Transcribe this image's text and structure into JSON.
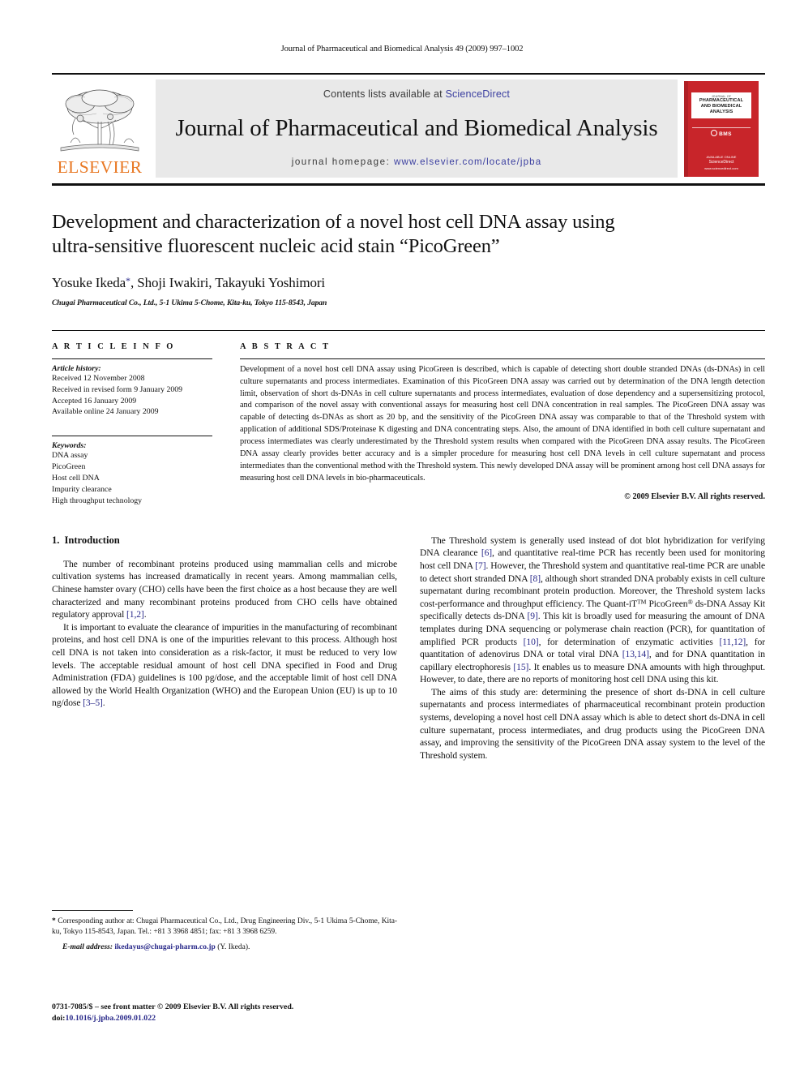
{
  "running_head": "Journal of Pharmaceutical and Biomedical Analysis 49 (2009) 997–1002",
  "masthead": {
    "publisher_logo_label": "ELSEVIER",
    "contents_prefix": "Contents lists available at ",
    "contents_link": "ScienceDirect",
    "journal_name": "Journal of Pharmaceutical and Biomedical Analysis",
    "homepage_prefix": "journal homepage: ",
    "homepage_url": "www.elsevier.com/locate/jpba",
    "cover": {
      "line1": "JOURNAL OF",
      "line2": "PHARMACEUTICAL",
      "line3": "AND BIOMEDICAL",
      "line4": "ANALYSIS",
      "badge": "BMS",
      "foot1": "AVAILABLE ONLINE",
      "foot2": "ScienceDirect",
      "foot3": "www.sciencedirect.com"
    },
    "accent_red": "#c8252a",
    "accent_orange": "#E87722",
    "link_blue": "#3b3fa0"
  },
  "article": {
    "title_line1": "Development and characterization of a novel host cell DNA assay using",
    "title_line2": "ultra-sensitive fluorescent nucleic acid stain “PicoGreen”",
    "authors": "Yosuke Ikeda",
    "authors_rest": ", Shoji Iwakiri, Takayuki Yoshimori",
    "corresponding_marker": "*",
    "affiliation": "Chugai Pharmaceutical Co., Ltd., 5-1 Ukima 5-Chome, Kita-ku, Tokyo 115-8543, Japan"
  },
  "article_info": {
    "heading": "A R T I C L E   I N F O",
    "history_label": "Article history:",
    "history": [
      "Received 12 November 2008",
      "Received in revised form 9 January 2009",
      "Accepted 16 January 2009",
      "Available online 24 January 2009"
    ],
    "keywords_label": "Keywords:",
    "keywords": [
      "DNA assay",
      "PicoGreen",
      "Host cell DNA",
      "Impurity clearance",
      "High throughput technology"
    ]
  },
  "abstract": {
    "heading": "A B S T R A C T",
    "text": "Development of a novel host cell DNA assay using PicoGreen is described, which is capable of detecting short double stranded DNAs (ds-DNAs) in cell culture supernatants and process intermediates. Examination of this PicoGreen DNA assay was carried out by determination of the DNA length detection limit, observation of short ds-DNAs in cell culture supernatants and process intermediates, evaluation of dose dependency and a supersensitizing protocol, and comparison of the novel assay with conventional assays for measuring host cell DNA concentration in real samples. The PicoGreen DNA assay was capable of detecting ds-DNAs as short as 20 bp, and the sensitivity of the PicoGreen DNA assay was comparable to that of the Threshold system with application of additional SDS/Proteinase K digesting and DNA concentrating steps. Also, the amount of DNA identified in both cell culture supernatant and process intermediates was clearly underestimated by the Threshold system results when compared with the PicoGreen DNA assay results. The PicoGreen DNA assay clearly provides better accuracy and is a simpler procedure for measuring host cell DNA levels in cell culture supernatant and process intermediates than the conventional method with the Threshold system. This newly developed DNA assay will be prominent among host cell DNA assays for measuring host cell DNA levels in bio-pharmaceuticals.",
    "copyright": "© 2009 Elsevier B.V. All rights reserved."
  },
  "introduction": {
    "number": "1.",
    "title": "Introduction",
    "left_paragraphs": [
      {
        "segments": [
          {
            "t": "The number of recombinant proteins produced using mammalian cells and microbe cultivation systems has increased dramatically in recent years. Among mammalian cells, Chinese hamster ovary (CHO) cells have been the first choice as a host because they are well characterized and many recombinant proteins produced from CHO cells have obtained regulatory approval "
          },
          {
            "t": "[1,2]",
            "k": "ref"
          },
          {
            "t": "."
          }
        ]
      },
      {
        "segments": [
          {
            "t": "It is important to evaluate the clearance of impurities in the manufacturing of recombinant proteins, and host cell DNA is one of the impurities relevant to this process. Although host cell DNA is not taken into consideration as a risk-factor, it must be reduced to very low levels. The acceptable residual amount of host cell DNA specified in Food and Drug Administration (FDA) guidelines is 100 pg/dose, and the acceptable limit of host cell DNA allowed by the World Health Organization (WHO) and the European Union (EU) is up to 10 ng/dose "
          },
          {
            "t": "[3–5]",
            "k": "ref"
          },
          {
            "t": "."
          }
        ]
      }
    ],
    "right_paragraphs": [
      {
        "segments": [
          {
            "t": "The Threshold system is generally used instead of dot blot hybridization for verifying DNA clearance "
          },
          {
            "t": "[6]",
            "k": "ref"
          },
          {
            "t": ", and quantitative real-time PCR has recently been used for monitoring host cell DNA "
          },
          {
            "t": "[7]",
            "k": "ref"
          },
          {
            "t": ". However, the Threshold system and quantitative real-time PCR are unable to detect short stranded DNA "
          },
          {
            "t": "[8]",
            "k": "ref"
          },
          {
            "t": ", although short stranded DNA probably exists in cell culture supernatant during recombinant protein production. Moreover, the Threshold system lacks cost-performance and throughput efficiency. The Quant-iT"
          },
          {
            "t": "TM",
            "k": "tm"
          },
          {
            "t": " PicoGreen"
          },
          {
            "t": "®",
            "k": "reg"
          },
          {
            "t": " ds-DNA Assay Kit specifically detects ds-DNA "
          },
          {
            "t": "[9]",
            "k": "ref"
          },
          {
            "t": ". This kit is broadly used for measuring the amount of DNA templates during DNA sequencing or polymerase chain reaction (PCR), for quantitation of amplified PCR products "
          },
          {
            "t": "[10]",
            "k": "ref"
          },
          {
            "t": ", for determination of enzymatic activities "
          },
          {
            "t": "[11,12]",
            "k": "ref"
          },
          {
            "t": ", for quantitation of adenovirus DNA or total viral DNA "
          },
          {
            "t": "[13,14]",
            "k": "ref"
          },
          {
            "t": ", and for DNA quantitation in capillary electrophoresis "
          },
          {
            "t": "[15]",
            "k": "ref"
          },
          {
            "t": ". It enables us to measure DNA amounts with high throughput. However, to date, there are no reports of monitoring host cell DNA using this kit."
          }
        ]
      },
      {
        "segments": [
          {
            "t": "The aims of this study are: determining the presence of short ds-DNA in cell culture supernatants and process intermediates of pharmaceutical recombinant protein production systems, developing a novel host cell DNA assay which is able to detect short ds-DNA in cell culture supernatant, process intermediates, and drug products using the PicoGreen DNA assay, and improving the sensitivity of the PicoGreen DNA assay system to the level of the Threshold system."
          }
        ]
      }
    ]
  },
  "footnotes": {
    "corresponding_star": "*",
    "corresponding_text": "Corresponding author at: Chugai Pharmaceutical Co., Ltd., Drug Engineering Div., 5-1 Ukima 5-Chome, Kita-ku, Tokyo 115-8543, Japan. Tel.: +81 3 3968 4851; fax: +81 3 3968 6259.",
    "email_label": "E-mail address:",
    "email_value": "ikedayus@chugai-pharm.co.jp",
    "email_suffix": "(Y. Ikeda).",
    "issn_line": "0731-7085/$ – see front matter © 2009 Elsevier B.V. All rights reserved.",
    "doi_label": "doi:",
    "doi_value": "10.1016/j.jpba.2009.01.022"
  }
}
